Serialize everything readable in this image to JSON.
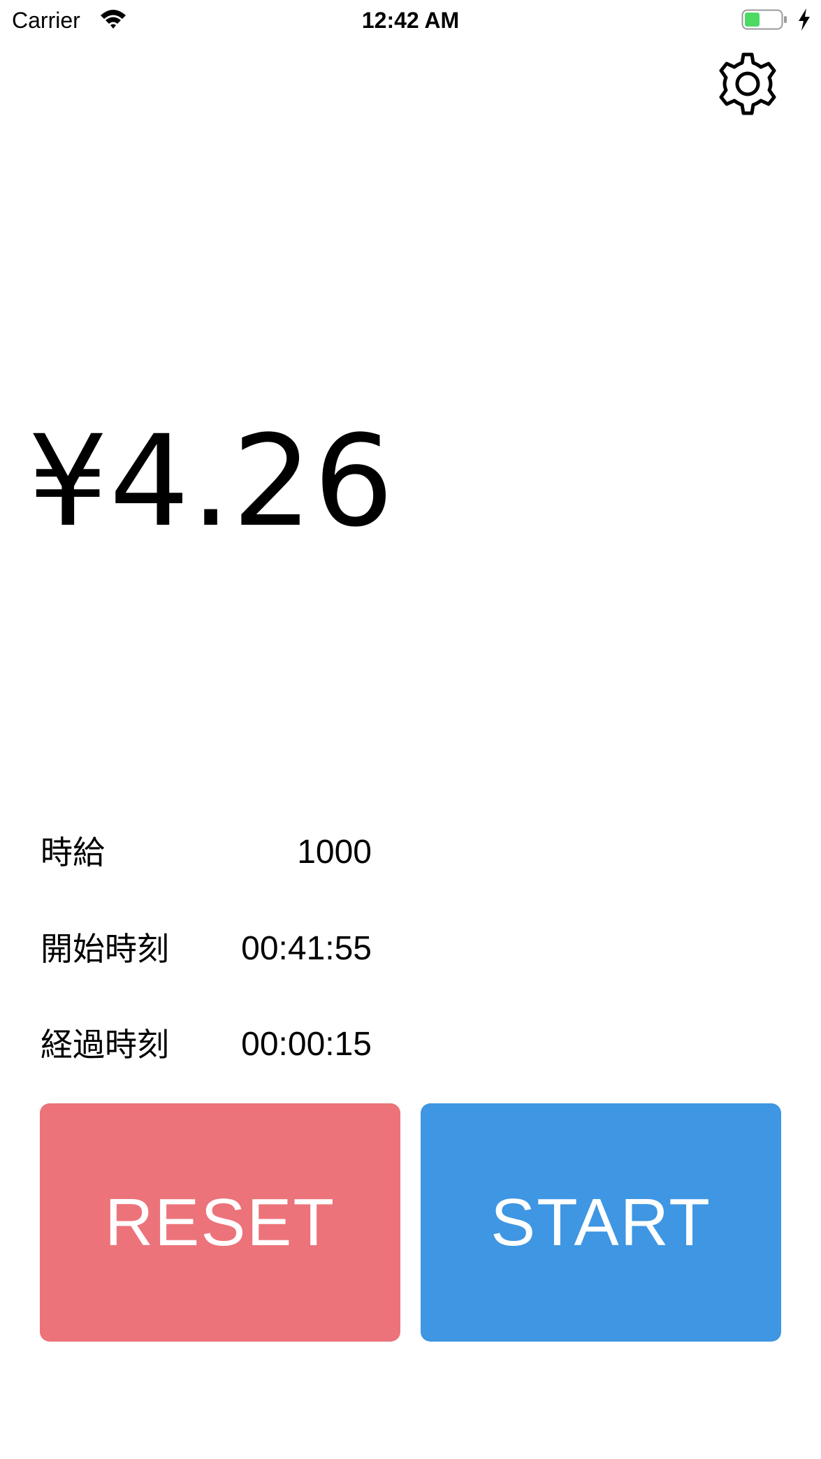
{
  "status_bar": {
    "carrier": "Carrier",
    "time": "12:42 AM",
    "battery_color": "#4cd964",
    "icons": [
      "wifi-icon",
      "battery-icon",
      "charging-bolt-icon"
    ]
  },
  "settings": {
    "icon": "gear-icon"
  },
  "earnings": {
    "amount": "¥4.26"
  },
  "info": {
    "hourly_wage_label": "時給",
    "hourly_wage_value": "1000",
    "start_time_label": "開始時刻",
    "start_time_value": "00:41:55",
    "elapsed_time_label": "経過時刻",
    "elapsed_time_value": "00:00:15"
  },
  "buttons": {
    "reset_label": "RESET",
    "reset_color": "#ec737a",
    "start_label": "START",
    "start_color": "#3f96e2"
  }
}
